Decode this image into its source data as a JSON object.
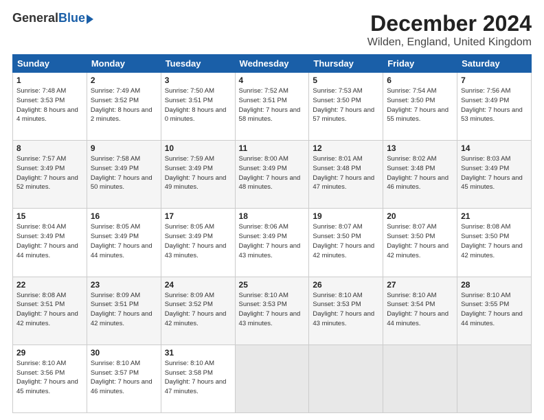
{
  "logo": {
    "general": "General",
    "blue": "Blue"
  },
  "title": "December 2024",
  "location": "Wilden, England, United Kingdom",
  "headers": [
    "Sunday",
    "Monday",
    "Tuesday",
    "Wednesday",
    "Thursday",
    "Friday",
    "Saturday"
  ],
  "weeks": [
    [
      {
        "day": "1",
        "sunrise": "Sunrise: 7:48 AM",
        "sunset": "Sunset: 3:53 PM",
        "daylight": "Daylight: 8 hours and 4 minutes."
      },
      {
        "day": "2",
        "sunrise": "Sunrise: 7:49 AM",
        "sunset": "Sunset: 3:52 PM",
        "daylight": "Daylight: 8 hours and 2 minutes."
      },
      {
        "day": "3",
        "sunrise": "Sunrise: 7:50 AM",
        "sunset": "Sunset: 3:51 PM",
        "daylight": "Daylight: 8 hours and 0 minutes."
      },
      {
        "day": "4",
        "sunrise": "Sunrise: 7:52 AM",
        "sunset": "Sunset: 3:51 PM",
        "daylight": "Daylight: 7 hours and 58 minutes."
      },
      {
        "day": "5",
        "sunrise": "Sunrise: 7:53 AM",
        "sunset": "Sunset: 3:50 PM",
        "daylight": "Daylight: 7 hours and 57 minutes."
      },
      {
        "day": "6",
        "sunrise": "Sunrise: 7:54 AM",
        "sunset": "Sunset: 3:50 PM",
        "daylight": "Daylight: 7 hours and 55 minutes."
      },
      {
        "day": "7",
        "sunrise": "Sunrise: 7:56 AM",
        "sunset": "Sunset: 3:49 PM",
        "daylight": "Daylight: 7 hours and 53 minutes."
      }
    ],
    [
      {
        "day": "8",
        "sunrise": "Sunrise: 7:57 AM",
        "sunset": "Sunset: 3:49 PM",
        "daylight": "Daylight: 7 hours and 52 minutes."
      },
      {
        "day": "9",
        "sunrise": "Sunrise: 7:58 AM",
        "sunset": "Sunset: 3:49 PM",
        "daylight": "Daylight: 7 hours and 50 minutes."
      },
      {
        "day": "10",
        "sunrise": "Sunrise: 7:59 AM",
        "sunset": "Sunset: 3:49 PM",
        "daylight": "Daylight: 7 hours and 49 minutes."
      },
      {
        "day": "11",
        "sunrise": "Sunrise: 8:00 AM",
        "sunset": "Sunset: 3:49 PM",
        "daylight": "Daylight: 7 hours and 48 minutes."
      },
      {
        "day": "12",
        "sunrise": "Sunrise: 8:01 AM",
        "sunset": "Sunset: 3:48 PM",
        "daylight": "Daylight: 7 hours and 47 minutes."
      },
      {
        "day": "13",
        "sunrise": "Sunrise: 8:02 AM",
        "sunset": "Sunset: 3:48 PM",
        "daylight": "Daylight: 7 hours and 46 minutes."
      },
      {
        "day": "14",
        "sunrise": "Sunrise: 8:03 AM",
        "sunset": "Sunset: 3:49 PM",
        "daylight": "Daylight: 7 hours and 45 minutes."
      }
    ],
    [
      {
        "day": "15",
        "sunrise": "Sunrise: 8:04 AM",
        "sunset": "Sunset: 3:49 PM",
        "daylight": "Daylight: 7 hours and 44 minutes."
      },
      {
        "day": "16",
        "sunrise": "Sunrise: 8:05 AM",
        "sunset": "Sunset: 3:49 PM",
        "daylight": "Daylight: 7 hours and 44 minutes."
      },
      {
        "day": "17",
        "sunrise": "Sunrise: 8:05 AM",
        "sunset": "Sunset: 3:49 PM",
        "daylight": "Daylight: 7 hours and 43 minutes."
      },
      {
        "day": "18",
        "sunrise": "Sunrise: 8:06 AM",
        "sunset": "Sunset: 3:49 PM",
        "daylight": "Daylight: 7 hours and 43 minutes."
      },
      {
        "day": "19",
        "sunrise": "Sunrise: 8:07 AM",
        "sunset": "Sunset: 3:50 PM",
        "daylight": "Daylight: 7 hours and 42 minutes."
      },
      {
        "day": "20",
        "sunrise": "Sunrise: 8:07 AM",
        "sunset": "Sunset: 3:50 PM",
        "daylight": "Daylight: 7 hours and 42 minutes."
      },
      {
        "day": "21",
        "sunrise": "Sunrise: 8:08 AM",
        "sunset": "Sunset: 3:50 PM",
        "daylight": "Daylight: 7 hours and 42 minutes."
      }
    ],
    [
      {
        "day": "22",
        "sunrise": "Sunrise: 8:08 AM",
        "sunset": "Sunset: 3:51 PM",
        "daylight": "Daylight: 7 hours and 42 minutes."
      },
      {
        "day": "23",
        "sunrise": "Sunrise: 8:09 AM",
        "sunset": "Sunset: 3:51 PM",
        "daylight": "Daylight: 7 hours and 42 minutes."
      },
      {
        "day": "24",
        "sunrise": "Sunrise: 8:09 AM",
        "sunset": "Sunset: 3:52 PM",
        "daylight": "Daylight: 7 hours and 42 minutes."
      },
      {
        "day": "25",
        "sunrise": "Sunrise: 8:10 AM",
        "sunset": "Sunset: 3:53 PM",
        "daylight": "Daylight: 7 hours and 43 minutes."
      },
      {
        "day": "26",
        "sunrise": "Sunrise: 8:10 AM",
        "sunset": "Sunset: 3:53 PM",
        "daylight": "Daylight: 7 hours and 43 minutes."
      },
      {
        "day": "27",
        "sunrise": "Sunrise: 8:10 AM",
        "sunset": "Sunset: 3:54 PM",
        "daylight": "Daylight: 7 hours and 44 minutes."
      },
      {
        "day": "28",
        "sunrise": "Sunrise: 8:10 AM",
        "sunset": "Sunset: 3:55 PM",
        "daylight": "Daylight: 7 hours and 44 minutes."
      }
    ],
    [
      {
        "day": "29",
        "sunrise": "Sunrise: 8:10 AM",
        "sunset": "Sunset: 3:56 PM",
        "daylight": "Daylight: 7 hours and 45 minutes."
      },
      {
        "day": "30",
        "sunrise": "Sunrise: 8:10 AM",
        "sunset": "Sunset: 3:57 PM",
        "daylight": "Daylight: 7 hours and 46 minutes."
      },
      {
        "day": "31",
        "sunrise": "Sunrise: 8:10 AM",
        "sunset": "Sunset: 3:58 PM",
        "daylight": "Daylight: 7 hours and 47 minutes."
      },
      null,
      null,
      null,
      null
    ]
  ]
}
